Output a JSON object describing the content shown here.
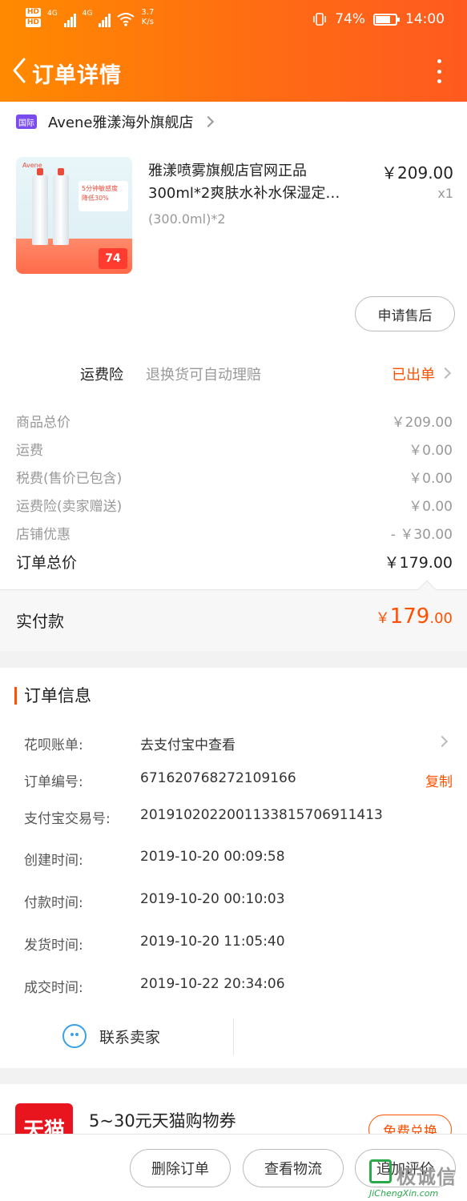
{
  "status_bar": {
    "hd1": "HD",
    "hd2": "HD",
    "net1": "4G",
    "net2": "4G",
    "speed_value": "3.7",
    "speed_unit": "K/s",
    "battery": "74%",
    "time": "14:00"
  },
  "nav": {
    "title": "订单详情"
  },
  "store": {
    "badge": "国际",
    "name": "Avene雅漾海外旗舰店"
  },
  "product": {
    "title_line1": "雅漾喷雾旗舰店官网正品",
    "title_line2": "300ml*2爽肤水补水保湿定…",
    "spec": "(300.0ml)*2",
    "price": "￥209.00",
    "qty": "x1",
    "img_brand": "Avene",
    "img_promo": "5分钟敏感度 降低30%",
    "img_price": "74"
  },
  "after_sale_button": "申请售后",
  "insurance": {
    "label": "运费险",
    "desc": "退换货可自动理赔",
    "status": "已出单"
  },
  "fees": [
    {
      "label": "商品总价",
      "value": "￥209.00"
    },
    {
      "label": "运费",
      "value": "￥0.00"
    },
    {
      "label": "税费(售价已包含)",
      "value": "￥0.00"
    },
    {
      "label": "运费险(卖家赠送)",
      "value": "￥0.00"
    },
    {
      "label": "店铺优惠",
      "value": "- ￥30.00"
    }
  ],
  "order_total": {
    "label": "订单总价",
    "value": "￥179.00"
  },
  "paid": {
    "label": "实付款",
    "currency": "￥",
    "int": "179",
    "dec": ".00"
  },
  "order_info": {
    "title": "订单信息",
    "rows": [
      {
        "key": "花呗账单:",
        "value": "去支付宝中查看"
      },
      {
        "key": "订单编号:",
        "value": "671620768272109166"
      },
      {
        "key": "支付宝交易号:",
        "value": "2019102022001133815706911413"
      },
      {
        "key": "创建时间:",
        "value": "2019-10-20 00:09:58"
      },
      {
        "key": "付款时间:",
        "value": "2019-10-20 00:10:03"
      },
      {
        "key": "发货时间:",
        "value": "2019-10-20 11:05:40"
      },
      {
        "key": "成交时间:",
        "value": "2019-10-22 20:34:06"
      }
    ],
    "copy_label": "复制",
    "contact_label": "联系卖家"
  },
  "coupon": {
    "logo": "天猫",
    "text": "5~30元天猫购物券",
    "button": "免费兑换"
  },
  "bottom_buttons": {
    "delete": "删除订单",
    "logistics": "查看物流",
    "review": "追加评价"
  },
  "watermark": {
    "text": "极诚信",
    "sub": "JiChengXin.com"
  },
  "colors": {
    "header_start": "#ff8a00",
    "header_end": "#ff5a1f",
    "accent": "#ff5000",
    "tmall_red": "#e8141e"
  }
}
